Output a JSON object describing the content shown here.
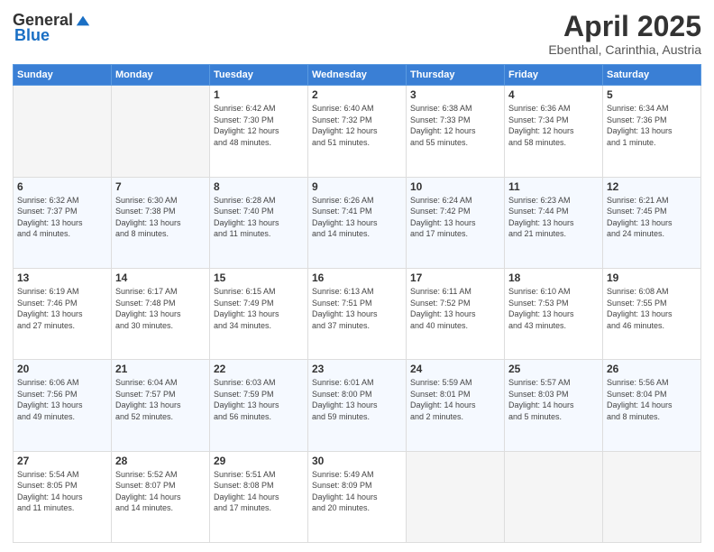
{
  "header": {
    "logo_general": "General",
    "logo_blue": "Blue",
    "month_title": "April 2025",
    "location": "Ebenthal, Carinthia, Austria"
  },
  "weekdays": [
    "Sunday",
    "Monday",
    "Tuesday",
    "Wednesday",
    "Thursday",
    "Friday",
    "Saturday"
  ],
  "weeks": [
    [
      {
        "day": "",
        "info": ""
      },
      {
        "day": "",
        "info": ""
      },
      {
        "day": "1",
        "info": "Sunrise: 6:42 AM\nSunset: 7:30 PM\nDaylight: 12 hours\nand 48 minutes."
      },
      {
        "day": "2",
        "info": "Sunrise: 6:40 AM\nSunset: 7:32 PM\nDaylight: 12 hours\nand 51 minutes."
      },
      {
        "day": "3",
        "info": "Sunrise: 6:38 AM\nSunset: 7:33 PM\nDaylight: 12 hours\nand 55 minutes."
      },
      {
        "day": "4",
        "info": "Sunrise: 6:36 AM\nSunset: 7:34 PM\nDaylight: 12 hours\nand 58 minutes."
      },
      {
        "day": "5",
        "info": "Sunrise: 6:34 AM\nSunset: 7:36 PM\nDaylight: 13 hours\nand 1 minute."
      }
    ],
    [
      {
        "day": "6",
        "info": "Sunrise: 6:32 AM\nSunset: 7:37 PM\nDaylight: 13 hours\nand 4 minutes."
      },
      {
        "day": "7",
        "info": "Sunrise: 6:30 AM\nSunset: 7:38 PM\nDaylight: 13 hours\nand 8 minutes."
      },
      {
        "day": "8",
        "info": "Sunrise: 6:28 AM\nSunset: 7:40 PM\nDaylight: 13 hours\nand 11 minutes."
      },
      {
        "day": "9",
        "info": "Sunrise: 6:26 AM\nSunset: 7:41 PM\nDaylight: 13 hours\nand 14 minutes."
      },
      {
        "day": "10",
        "info": "Sunrise: 6:24 AM\nSunset: 7:42 PM\nDaylight: 13 hours\nand 17 minutes."
      },
      {
        "day": "11",
        "info": "Sunrise: 6:23 AM\nSunset: 7:44 PM\nDaylight: 13 hours\nand 21 minutes."
      },
      {
        "day": "12",
        "info": "Sunrise: 6:21 AM\nSunset: 7:45 PM\nDaylight: 13 hours\nand 24 minutes."
      }
    ],
    [
      {
        "day": "13",
        "info": "Sunrise: 6:19 AM\nSunset: 7:46 PM\nDaylight: 13 hours\nand 27 minutes."
      },
      {
        "day": "14",
        "info": "Sunrise: 6:17 AM\nSunset: 7:48 PM\nDaylight: 13 hours\nand 30 minutes."
      },
      {
        "day": "15",
        "info": "Sunrise: 6:15 AM\nSunset: 7:49 PM\nDaylight: 13 hours\nand 34 minutes."
      },
      {
        "day": "16",
        "info": "Sunrise: 6:13 AM\nSunset: 7:51 PM\nDaylight: 13 hours\nand 37 minutes."
      },
      {
        "day": "17",
        "info": "Sunrise: 6:11 AM\nSunset: 7:52 PM\nDaylight: 13 hours\nand 40 minutes."
      },
      {
        "day": "18",
        "info": "Sunrise: 6:10 AM\nSunset: 7:53 PM\nDaylight: 13 hours\nand 43 minutes."
      },
      {
        "day": "19",
        "info": "Sunrise: 6:08 AM\nSunset: 7:55 PM\nDaylight: 13 hours\nand 46 minutes."
      }
    ],
    [
      {
        "day": "20",
        "info": "Sunrise: 6:06 AM\nSunset: 7:56 PM\nDaylight: 13 hours\nand 49 minutes."
      },
      {
        "day": "21",
        "info": "Sunrise: 6:04 AM\nSunset: 7:57 PM\nDaylight: 13 hours\nand 52 minutes."
      },
      {
        "day": "22",
        "info": "Sunrise: 6:03 AM\nSunset: 7:59 PM\nDaylight: 13 hours\nand 56 minutes."
      },
      {
        "day": "23",
        "info": "Sunrise: 6:01 AM\nSunset: 8:00 PM\nDaylight: 13 hours\nand 59 minutes."
      },
      {
        "day": "24",
        "info": "Sunrise: 5:59 AM\nSunset: 8:01 PM\nDaylight: 14 hours\nand 2 minutes."
      },
      {
        "day": "25",
        "info": "Sunrise: 5:57 AM\nSunset: 8:03 PM\nDaylight: 14 hours\nand 5 minutes."
      },
      {
        "day": "26",
        "info": "Sunrise: 5:56 AM\nSunset: 8:04 PM\nDaylight: 14 hours\nand 8 minutes."
      }
    ],
    [
      {
        "day": "27",
        "info": "Sunrise: 5:54 AM\nSunset: 8:05 PM\nDaylight: 14 hours\nand 11 minutes."
      },
      {
        "day": "28",
        "info": "Sunrise: 5:52 AM\nSunset: 8:07 PM\nDaylight: 14 hours\nand 14 minutes."
      },
      {
        "day": "29",
        "info": "Sunrise: 5:51 AM\nSunset: 8:08 PM\nDaylight: 14 hours\nand 17 minutes."
      },
      {
        "day": "30",
        "info": "Sunrise: 5:49 AM\nSunset: 8:09 PM\nDaylight: 14 hours\nand 20 minutes."
      },
      {
        "day": "",
        "info": ""
      },
      {
        "day": "",
        "info": ""
      },
      {
        "day": "",
        "info": ""
      }
    ]
  ]
}
